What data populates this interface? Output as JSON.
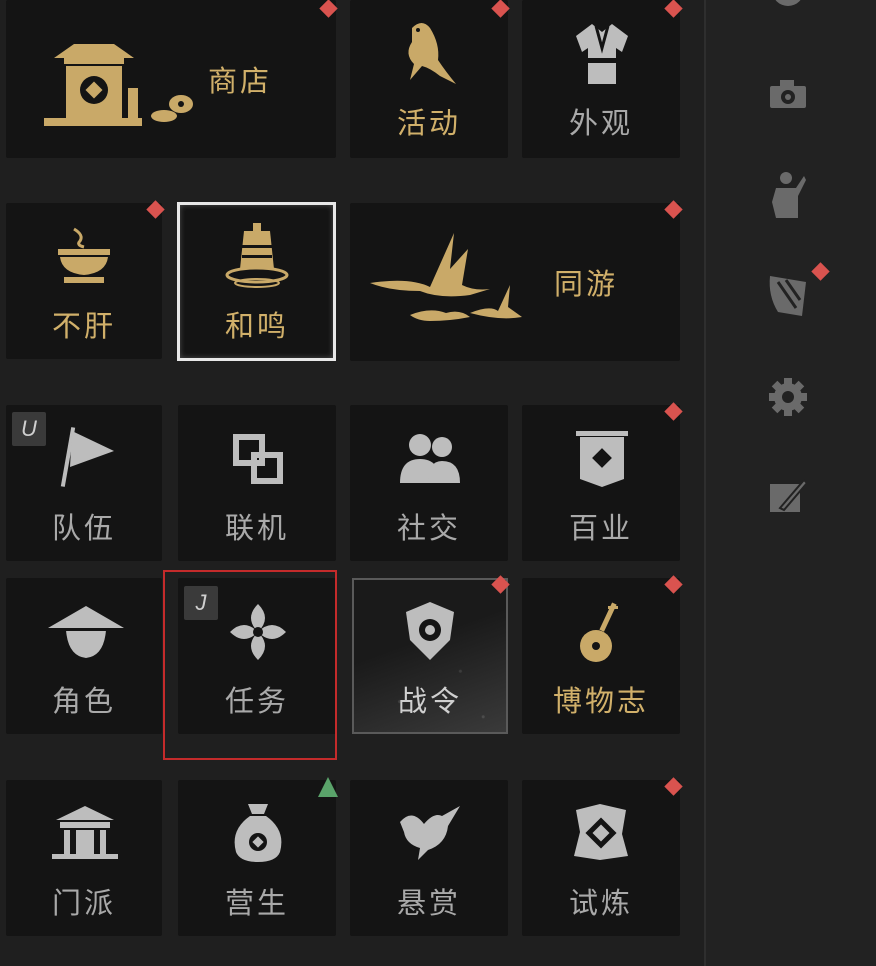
{
  "menu": {
    "tiles": [
      {
        "id": "shop",
        "label": "商店",
        "badge": "red",
        "icon": "shop-pavilion-coins-icon"
      },
      {
        "id": "events",
        "label": "活动",
        "badge": "red",
        "icon": "bird-icon"
      },
      {
        "id": "appearance",
        "label": "外观",
        "badge": "red",
        "icon": "robe-icon"
      },
      {
        "id": "buugan",
        "label": "不肝",
        "badge": "red",
        "icon": "tea-bowl-icon"
      },
      {
        "id": "heming",
        "label": "和鸣",
        "badge": "",
        "icon": "bell-ripple-icon"
      },
      {
        "id": "tongyou",
        "label": "同游",
        "badge": "red",
        "icon": "cranes-icon"
      },
      {
        "id": "team",
        "label": "队伍",
        "badge": "",
        "hotkey": "U",
        "icon": "flag-icon"
      },
      {
        "id": "online",
        "label": "联机",
        "badge": "",
        "icon": "linked-squares-icon"
      },
      {
        "id": "social",
        "label": "社交",
        "badge": "",
        "icon": "people-icon"
      },
      {
        "id": "occupations",
        "label": "百业",
        "badge": "red",
        "icon": "banner-icon"
      },
      {
        "id": "character",
        "label": "角色",
        "badge": "",
        "icon": "straw-hat-icon"
      },
      {
        "id": "quests",
        "label": "任务",
        "badge": "",
        "hotkey": "J",
        "icon": "four-petal-icon"
      },
      {
        "id": "battlepass",
        "label": "战令",
        "badge": "red",
        "icon": "shield-emblem-icon"
      },
      {
        "id": "museum",
        "label": "博物志",
        "badge": "red",
        "icon": "pipa-icon"
      },
      {
        "id": "sect",
        "label": "门派",
        "badge": "",
        "icon": "temple-gate-icon"
      },
      {
        "id": "livelihood",
        "label": "营生",
        "badge": "green",
        "icon": "money-bag-icon"
      },
      {
        "id": "bounty",
        "label": "悬赏",
        "badge": "",
        "icon": "dove-icon"
      },
      {
        "id": "trial",
        "label": "试炼",
        "badge": "red",
        "icon": "spiral-icon"
      }
    ]
  },
  "rail": {
    "icons": [
      "clock-icon",
      "camera-icon",
      "gesture-pose-icon",
      "swirl-scroll-icon",
      "gear-icon",
      "painting-brush-icon"
    ]
  },
  "colors": {
    "gold": "#d1b06a",
    "grey": "#a9a9a9",
    "badge_red": "#d9534f",
    "badge_green": "#5aa36a",
    "highlight_red": "#c42b2b"
  }
}
